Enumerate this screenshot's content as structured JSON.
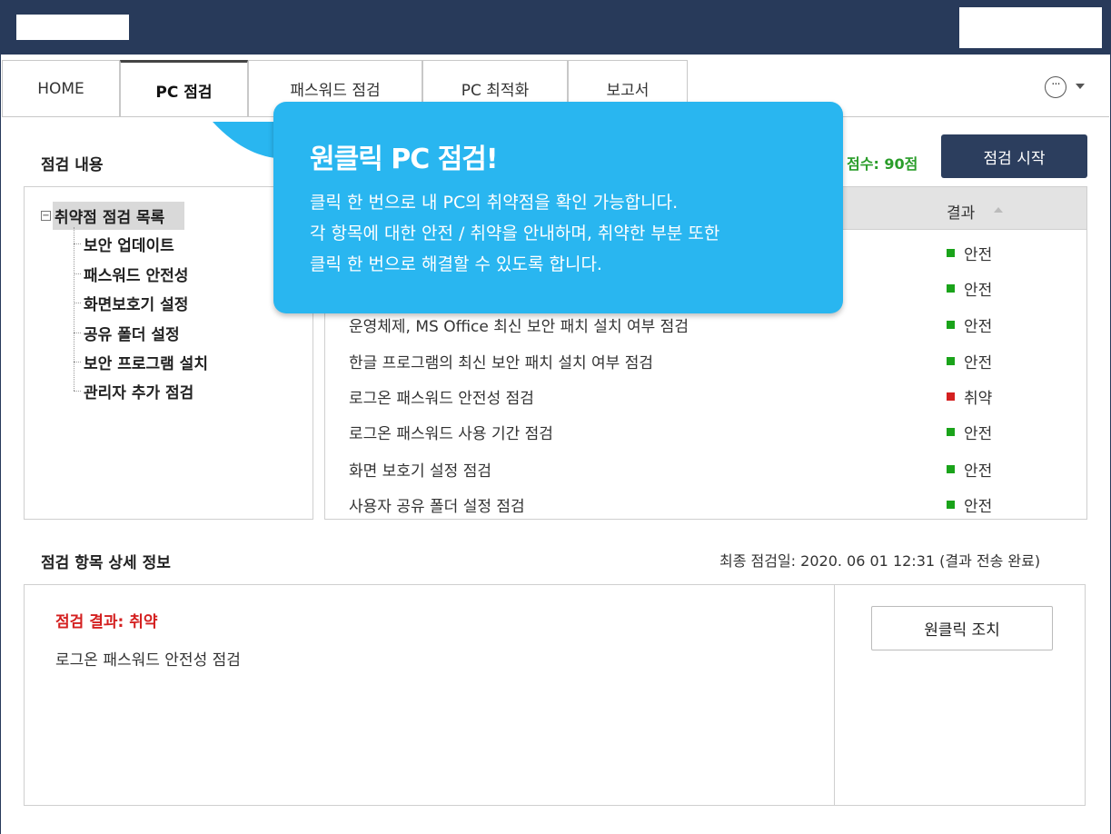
{
  "tabs": [
    {
      "label": "HOME",
      "active": false
    },
    {
      "label": "PC 점검",
      "active": true
    },
    {
      "label": "패스워드 점검",
      "active": false
    },
    {
      "label": "PC 최적화",
      "active": false
    },
    {
      "label": "보고서",
      "active": false
    }
  ],
  "toolbar": {
    "more_icon": "ellipsis-circle-icon",
    "more_label": "···"
  },
  "inspection": {
    "title": "점검 내용",
    "score_text": "점수: 90점",
    "start_button": "점검 시작"
  },
  "tree": {
    "toggle": "−",
    "root": "취약점 점검 목록",
    "items": [
      "보안 업데이트",
      "패스워드 안전성",
      "화면보호기 설정",
      "공유 폴더 설정",
      "보안 프로그램 설치",
      "관리자 추가 점검"
    ]
  },
  "list": {
    "result_header": "결과",
    "rows": [
      {
        "name": "",
        "status": "안전",
        "color": "#1aa31a"
      },
      {
        "name": "",
        "status": "안전",
        "color": "#1aa31a"
      },
      {
        "name": "운영체제, MS Office 최신 보안 패치 설치 여부 점검",
        "status": "안전",
        "color": "#1aa31a"
      },
      {
        "name": "한글 프로그램의 최신 보안 패치 설치 여부 점검",
        "status": "안전",
        "color": "#1aa31a"
      },
      {
        "name": "로그온 패스워드 안전성 점검",
        "status": "취약",
        "color": "#d42020"
      },
      {
        "name": "로그온 패스워드 사용 기간 점검",
        "status": "안전",
        "color": "#1aa31a"
      },
      {
        "name": "화면 보호기 설정 점검",
        "status": "안전",
        "color": "#1aa31a"
      },
      {
        "name": "사용자 공유 폴더 설정 점검",
        "status": "안전",
        "color": "#1aa31a"
      }
    ]
  },
  "detail": {
    "title": "점검 항목 상세 정보",
    "last_date": "최종 점검일: 2020. 06 01 12:31 (결과 전송 완료)",
    "result": "점검 결과: 취약",
    "description": "로그온 패스워드 안전성 점검",
    "fix_button": "원클릭 조치"
  },
  "callout": {
    "title": "원클릭 PC 점검!",
    "lines": [
      "클릭 한 번으로 내 PC의 취약점을 확인 가능합니다.",
      "각 항목에 대한 안전 / 취약을 안내하며, 취약한 부분 또한",
      "클릭 한 번으로 해결할 수 있도록 합니다."
    ]
  },
  "colors": {
    "titlebar": "#283a5a",
    "accent": "#29b6f0",
    "safe": "#1aa31a",
    "vulnerable": "#d42020",
    "score": "#2a9d2a"
  }
}
